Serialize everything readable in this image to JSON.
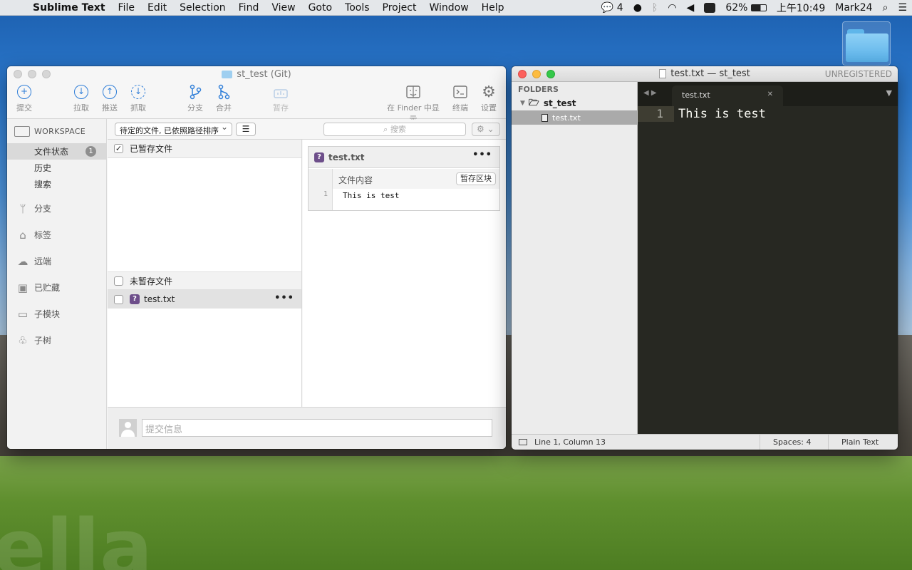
{
  "menubar": {
    "app": "Sublime Text",
    "items": [
      "File",
      "Edit",
      "Selection",
      "Find",
      "View",
      "Goto",
      "Tools",
      "Project",
      "Window",
      "Help"
    ],
    "wechat_count": "4",
    "battery": "62%",
    "time": "上午10:49",
    "user": "Mark24"
  },
  "sourcetree": {
    "title": "st_test (Git)",
    "toolbar": {
      "commit": "提交",
      "pull": "拉取",
      "push": "推送",
      "fetch": "抓取",
      "branch": "分支",
      "merge": "合并",
      "stash": "暂存",
      "finder": "在 Finder 中显示",
      "terminal": "终端",
      "settings": "设置"
    },
    "sidebar": {
      "workspace": "WORKSPACE",
      "items": [
        {
          "label": "文件状态",
          "badge": "1"
        },
        {
          "label": "历史"
        },
        {
          "label": "搜索"
        }
      ],
      "groups": [
        "分支",
        "标签",
        "远端",
        "已贮藏",
        "子模块",
        "子树"
      ]
    },
    "filebar": {
      "sort": "待定的文件, 已依照路径排序",
      "search_placeholder": "搜索"
    },
    "staged_header": "已暂存文件",
    "unstaged_header": "未暂存文件",
    "unstaged_file": "test.txt",
    "diff": {
      "filename": "test.txt",
      "hunk_title": "文件内容",
      "hunk_button": "暂存区块",
      "line_no": "1",
      "line": "This is test"
    },
    "commit_placeholder": "提交信息"
  },
  "sublime": {
    "title": "test.txt — st_test",
    "unregistered": "UNREGISTERED",
    "folders_label": "FOLDERS",
    "folder": "st_test",
    "file": "test.txt",
    "tab": "test.txt",
    "line_no": "1",
    "line_text": "This is test",
    "status": {
      "position": "Line 1, Column 13",
      "spaces": "Spaces: 4",
      "syntax": "Plain Text"
    }
  }
}
